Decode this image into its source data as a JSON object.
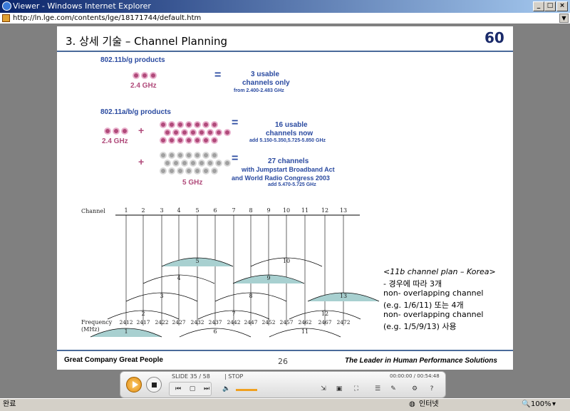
{
  "window": {
    "title": "Viewer - Windows Internet Explorer",
    "url": "http://ln.lge.com/contents/lge/18171744/default.htm"
  },
  "slide": {
    "title": "3. 상세 기술 – Channel Planning",
    "logo": "60",
    "bg_label": "802.11b/g products",
    "bg_freq": "2.4 GHz",
    "bg_eq": "=",
    "bg_result1": "3 usable",
    "bg_result2": "channels only",
    "bg_result3": "from 2.400-2.483 GHz",
    "abg_label": "802.11a/b/g products",
    "abg_freq24": "2.4 GHz",
    "plus": "+",
    "eq": "=",
    "r16a": "16 usable",
    "r16b": "channels now",
    "r16c": "add 5.150-5.350,5.725-5.850 GHz",
    "r27a": "27 channels",
    "r27b": "with Jumpstart Broadband Act",
    "r27c": "and World Radio Congress 2003",
    "r27d": "add 5.470-5.725 GHz",
    "freq5": "5 GHz",
    "channel_label": "Channel",
    "channels": [
      "1",
      "2",
      "3",
      "4",
      "5",
      "6",
      "7",
      "8",
      "9",
      "10",
      "11",
      "12",
      "13"
    ],
    "freq_label1": "Frequency",
    "freq_label2": "(MHz)",
    "freqs": [
      "2412",
      "2417",
      "2422",
      "2427",
      "2432",
      "2437",
      "2442",
      "2447",
      "2452",
      "2457",
      "2462",
      "2467",
      "2472"
    ],
    "note1": "<11b channel plan – Korea>",
    "note2": "- 경우에 따라 3개",
    "note3": "non- overlapping channel",
    "note4": "(e.g. 1/6/11) 또는 4개",
    "note5": "non- overlapping channel",
    "note6": "(e.g. 1/5/9/13) 사용",
    "footer_left": "Great Company   Great People",
    "page": "26",
    "footer_right": "The Leader in Human Performance Solutions"
  },
  "player": {
    "slide": "SLIDE  35 / 58",
    "stop": "| STOP",
    "time": "00:00:00 / 00:54:48"
  },
  "status": {
    "left": "완료",
    "zone": "인터넷",
    "zoom": "100%"
  }
}
